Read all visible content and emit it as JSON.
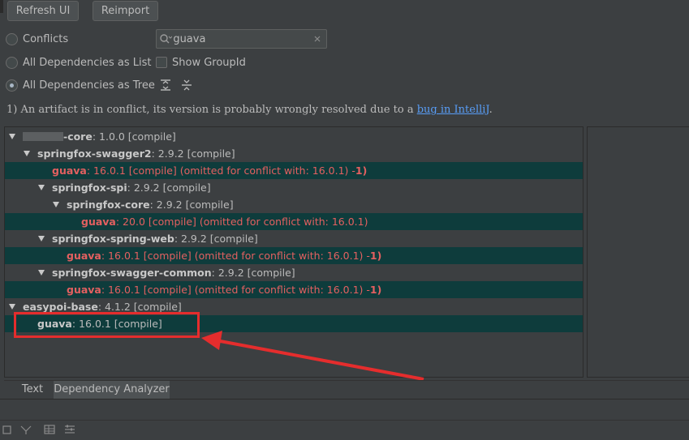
{
  "toolbar": {
    "refresh_label": "Refresh UI",
    "reimport_label": "Reimport"
  },
  "options": {
    "conflicts_label": "Conflicts",
    "list_label": "All Dependencies as List",
    "tree_label": "All Dependencies as Tree",
    "selected_mode": "All Dependencies as Tree",
    "show_groupid_label": "Show GroupId",
    "show_groupid_checked": false
  },
  "search": {
    "value": "guava"
  },
  "info": {
    "text": "1) An artifact is in conflict, its version is probably wrongly resolved due to a ",
    "link_text": "bug in IntelliJ",
    "suffix": "."
  },
  "tree": {
    "rows": [
      {
        "artifact": "-core",
        "detail": " : 1.0.0 [compile]",
        "conflict": false,
        "expanded": true
      },
      {
        "artifact": "springfox-swagger2",
        "detail": " : 2.9.2 [compile]",
        "conflict": false,
        "expanded": true
      },
      {
        "artifact": "guava",
        "detail": " : 16.0.1 [compile] (omitted for conflict with: 16.0.1) - ",
        "marker": "1)",
        "conflict": true
      },
      {
        "artifact": "springfox-spi",
        "detail": " : 2.9.2 [compile]",
        "conflict": false,
        "expanded": true
      },
      {
        "artifact": "springfox-core",
        "detail": " : 2.9.2 [compile]",
        "conflict": false,
        "expanded": true
      },
      {
        "artifact": "guava",
        "detail": " : 20.0 [compile] (omitted for conflict with: 16.0.1)",
        "conflict": true
      },
      {
        "artifact": "springfox-spring-web",
        "detail": " : 2.9.2 [compile]",
        "conflict": false,
        "expanded": true
      },
      {
        "artifact": "guava",
        "detail": " : 16.0.1 [compile] (omitted for conflict with: 16.0.1) - ",
        "marker": "1)",
        "conflict": true
      },
      {
        "artifact": "springfox-swagger-common",
        "detail": " : 2.9.2 [compile]",
        "conflict": false,
        "expanded": true
      },
      {
        "artifact": "guava",
        "detail": " : 16.0.1 [compile] (omitted for conflict with: 16.0.1) - ",
        "marker": "1)",
        "conflict": true
      },
      {
        "artifact": "easypoi-base",
        "detail": " : 4.1.2 [compile]",
        "conflict": false,
        "expanded": true
      },
      {
        "artifact": "guava",
        "detail": " : 16.0.1 [compile]",
        "conflict": false,
        "selected": true
      }
    ]
  },
  "tabs": {
    "text_label": "Text",
    "analyzer_label": "Dependency Analyzer",
    "active": "Dependency Analyzer"
  },
  "colors": {
    "conflict_row_bg": "#0e3c3c",
    "conflict_text": "#e36060",
    "annotation_red": "#e52d2d",
    "link": "#589df6"
  },
  "icons": {
    "search": "search-icon",
    "clear": "close-icon",
    "expand_all": "expand-all-icon",
    "collapse_all": "collapse-all-icon"
  }
}
